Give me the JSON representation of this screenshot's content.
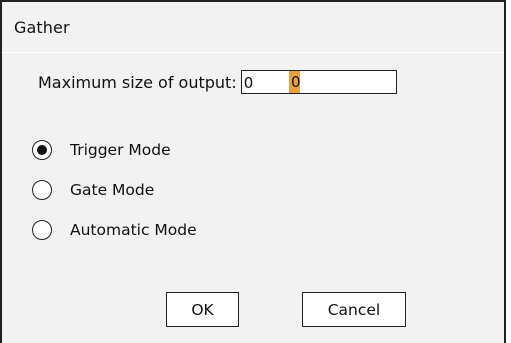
{
  "dialog": {
    "title": "Gather"
  },
  "max_size": {
    "label": "Maximum size of output:",
    "value": "0"
  },
  "modes": [
    {
      "label": "Trigger Mode",
      "checked": true
    },
    {
      "label": "Gate Mode",
      "checked": false
    },
    {
      "label": "Automatic Mode",
      "checked": false
    }
  ],
  "buttons": {
    "ok_label": "OK",
    "cancel_label": "Cancel"
  },
  "colors": {
    "dialog_background": "#f2f2f2",
    "border": "#222222",
    "selection_highlight": "#e8a23c"
  }
}
